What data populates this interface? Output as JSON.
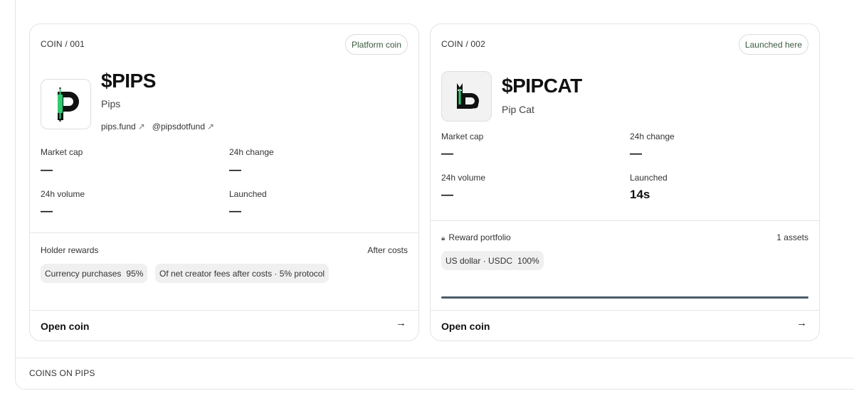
{
  "section": {
    "footer_label": "COINS ON PIPS"
  },
  "coins": [
    {
      "number": "COIN / 001",
      "badge": "Platform coin",
      "ticker": "$PIPS",
      "name": "Pips",
      "logo_icon": "pips-candlestick-logo",
      "links": [
        {
          "label": "pips.fund",
          "arrow": "↗"
        },
        {
          "label": "@pipsdotfund",
          "arrow": "↗"
        }
      ],
      "stats": {
        "market_cap_label": "Market cap",
        "market_cap_value": "—",
        "change_label": "24h change",
        "change_value": "—",
        "volume_label": "24h volume",
        "volume_value": "—",
        "launched_label": "Launched",
        "launched_value": "—"
      },
      "rewards": {
        "title": "Holder rewards",
        "right_label": "After costs",
        "chips": [
          {
            "label": "Currency purchases",
            "value": "95%"
          },
          {
            "label": "Of net creator fees after costs · 5% protocol",
            "value": ""
          }
        ]
      },
      "open_label": "Open coin",
      "open_arrow": "→"
    },
    {
      "number": "COIN / 002",
      "badge": "Launched here",
      "ticker": "$PIPCAT",
      "name": "Pip Cat",
      "logo_icon": "pip-cat-logo",
      "stats": {
        "market_cap_label": "Market cap",
        "market_cap_value": "—",
        "change_label": "24h change",
        "change_value": "—",
        "volume_label": "24h volume",
        "volume_value": "—",
        "launched_label": "Launched",
        "launched_value": "14s"
      },
      "rewards": {
        "title": "Reward portfolio",
        "right_label": "1 assets",
        "chips": [
          {
            "label": "US dollar · USDC",
            "value": "100%"
          }
        ],
        "allocation_fraction": 1.0
      },
      "open_label": "Open coin",
      "open_arrow": "→"
    }
  ],
  "colors": {
    "accent_green": "#2ecc71",
    "badge_text": "#3b5a3f",
    "progress": "#4b5a68"
  }
}
